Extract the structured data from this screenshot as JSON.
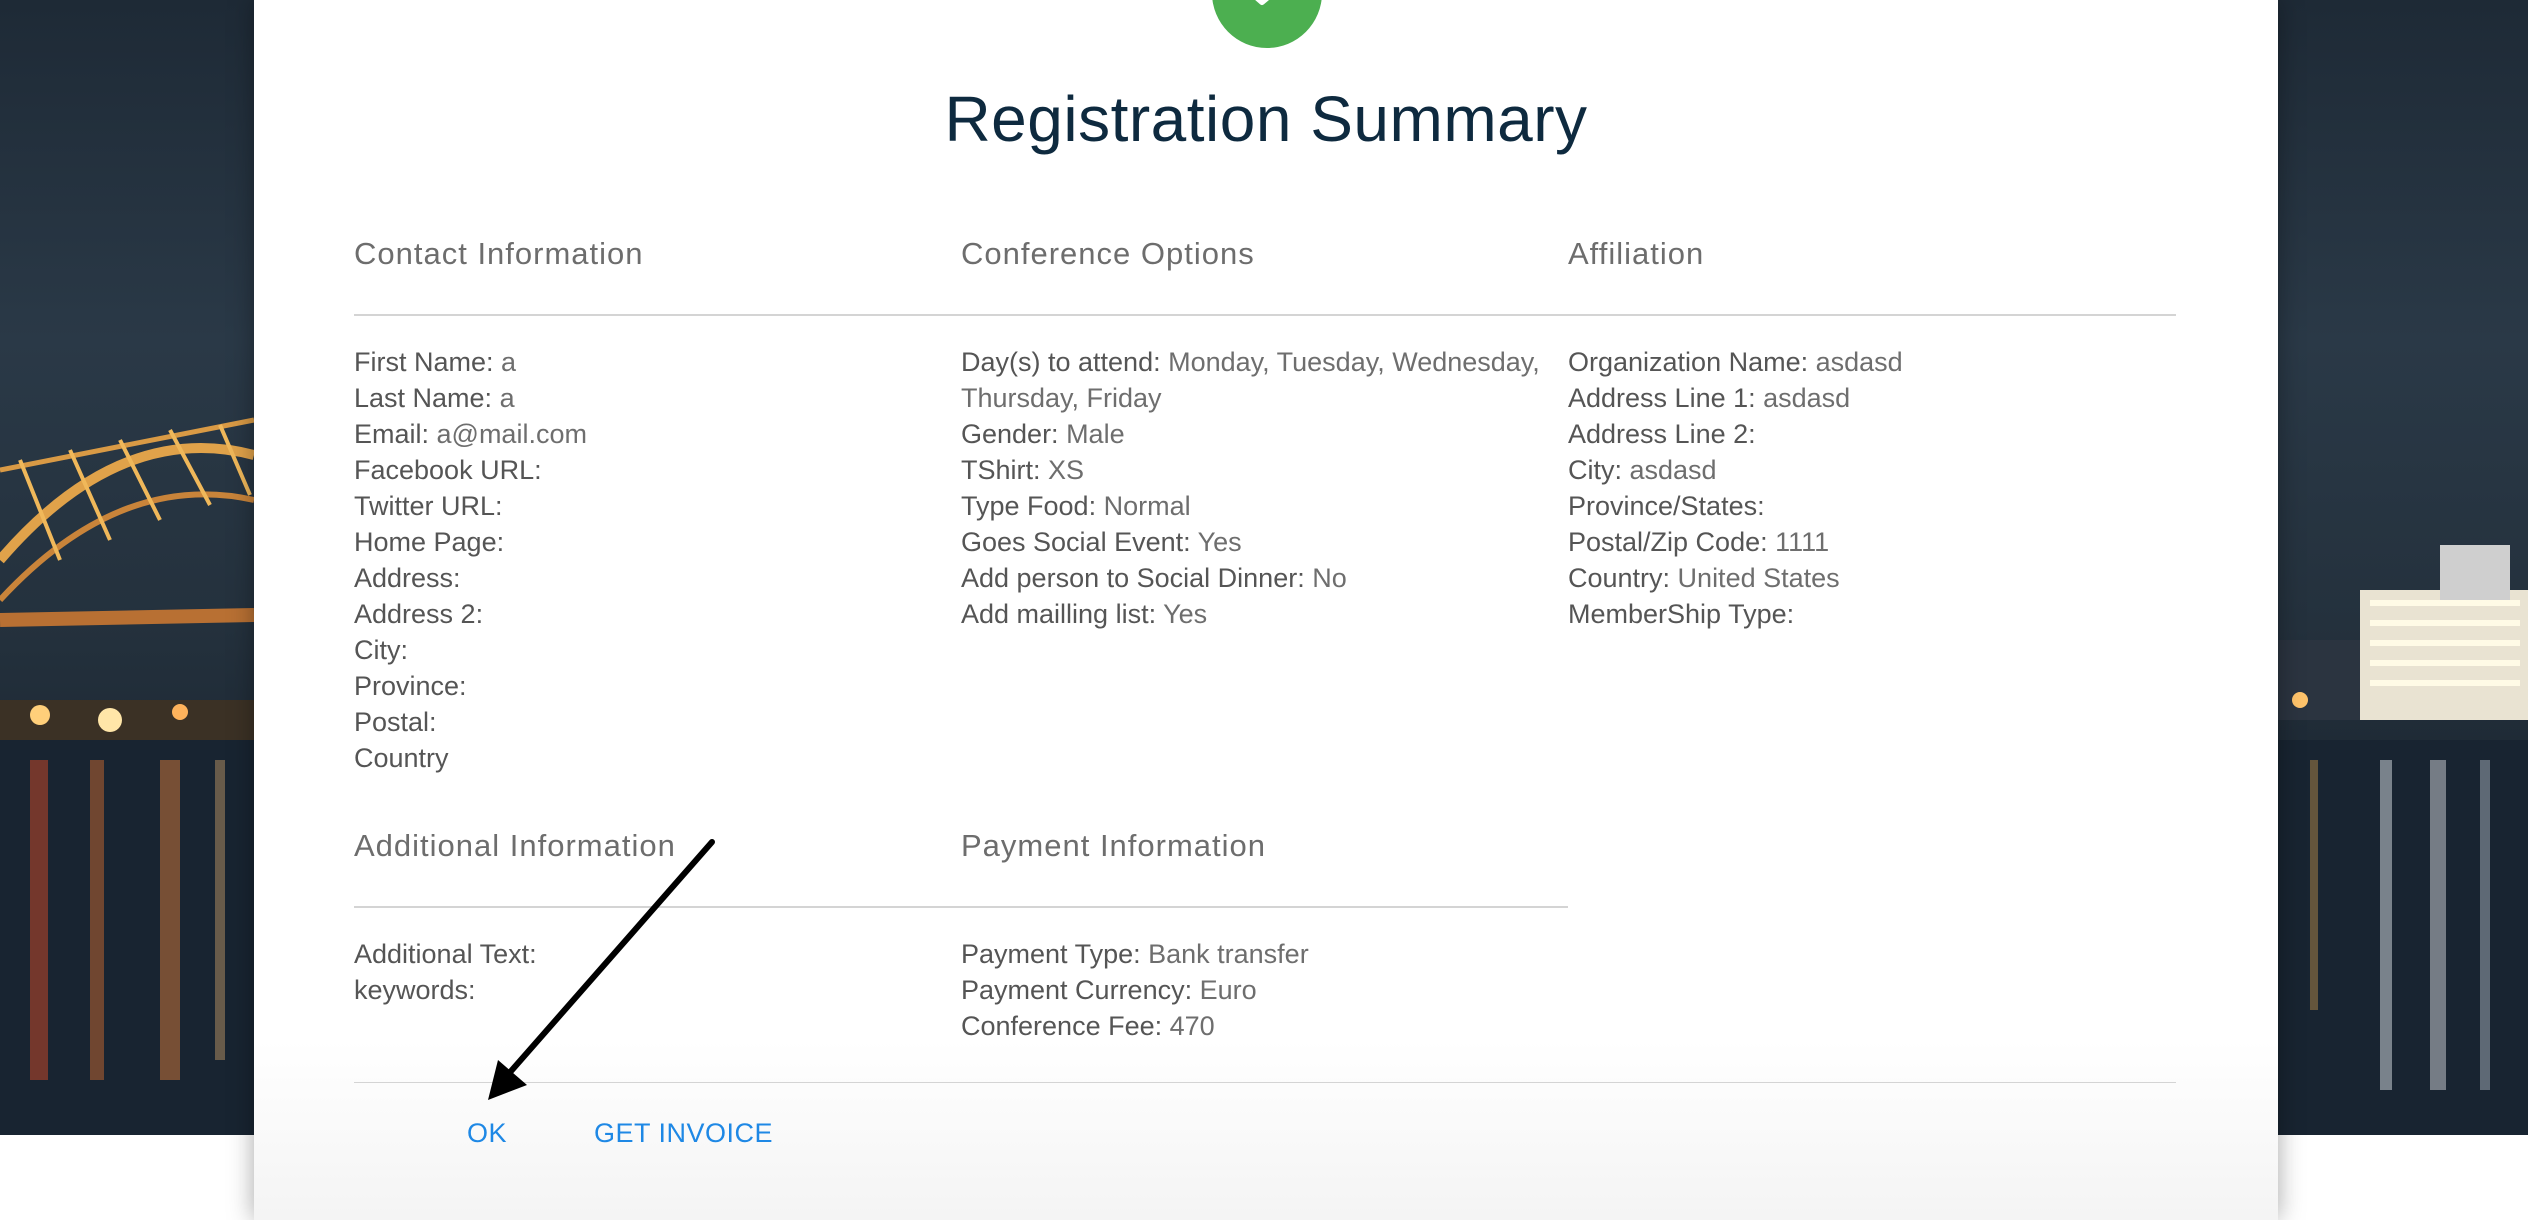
{
  "dialog": {
    "title": "Registration Summary"
  },
  "sections": {
    "contact": {
      "heading": "Contact Information",
      "fields": [
        {
          "label": "First Name:",
          "value": " a"
        },
        {
          "label": "Last Name:",
          "value": " a"
        },
        {
          "label": "Email:",
          "value": " a@mail.com"
        },
        {
          "label": "Facebook URL:",
          "value": ""
        },
        {
          "label": "Twitter URL:",
          "value": ""
        },
        {
          "label": "Home Page:",
          "value": ""
        },
        {
          "label": "Address:",
          "value": ""
        },
        {
          "label": "Address 2:",
          "value": ""
        },
        {
          "label": "City:",
          "value": ""
        },
        {
          "label": "Province:",
          "value": ""
        },
        {
          "label": "Postal:",
          "value": ""
        },
        {
          "label": "Country",
          "value": ""
        }
      ]
    },
    "conference": {
      "heading": "Conference Options",
      "fields": [
        {
          "label": "Day(s) to attend:",
          "value": " Monday, Tuesday, Wednesday, Thursday, Friday"
        },
        {
          "label": "Gender:",
          "value": " Male"
        },
        {
          "label": "TShirt:",
          "value": " XS"
        },
        {
          "label": "Type Food:",
          "value": " Normal"
        },
        {
          "label": "Goes Social Event:",
          "value": " Yes"
        },
        {
          "label": "Add person to Social Dinner:",
          "value": " No"
        },
        {
          "label": "Add mailling list:",
          "value": " Yes"
        }
      ]
    },
    "affiliation": {
      "heading": "Affiliation",
      "fields": [
        {
          "label": "Organization Name:",
          "value": " asdasd"
        },
        {
          "label": "Address Line 1:",
          "value": " asdasd"
        },
        {
          "label": "Address Line 2:",
          "value": ""
        },
        {
          "label": "City:",
          "value": " asdasd"
        },
        {
          "label": "Province/States:",
          "value": ""
        },
        {
          "label": "Postal/Zip Code:",
          "value": " 1111"
        },
        {
          "label": "Country:",
          "value": " United States"
        },
        {
          "label": "MemberShip Type:",
          "value": ""
        }
      ]
    },
    "additional": {
      "heading": "Additional Information",
      "fields": [
        {
          "label": "Additional Text:",
          "value": ""
        },
        {
          "label": "keywords:",
          "value": ""
        }
      ]
    },
    "payment": {
      "heading": "Payment Information",
      "fields": [
        {
          "label": "Payment Type:",
          "value": " Bank transfer"
        },
        {
          "label": "Payment Currency:",
          "value": " Euro"
        },
        {
          "label": "Conference Fee:",
          "value": " 470"
        }
      ]
    }
  },
  "actions": {
    "ok_label": "OK",
    "invoice_label": "GET INVOICE"
  },
  "colors": {
    "accent": "#1e88e5",
    "success": "#4caf50",
    "title": "#0e2a3f"
  },
  "icons": {
    "badge": "check-icon",
    "annotation": "arrow-pointer"
  }
}
